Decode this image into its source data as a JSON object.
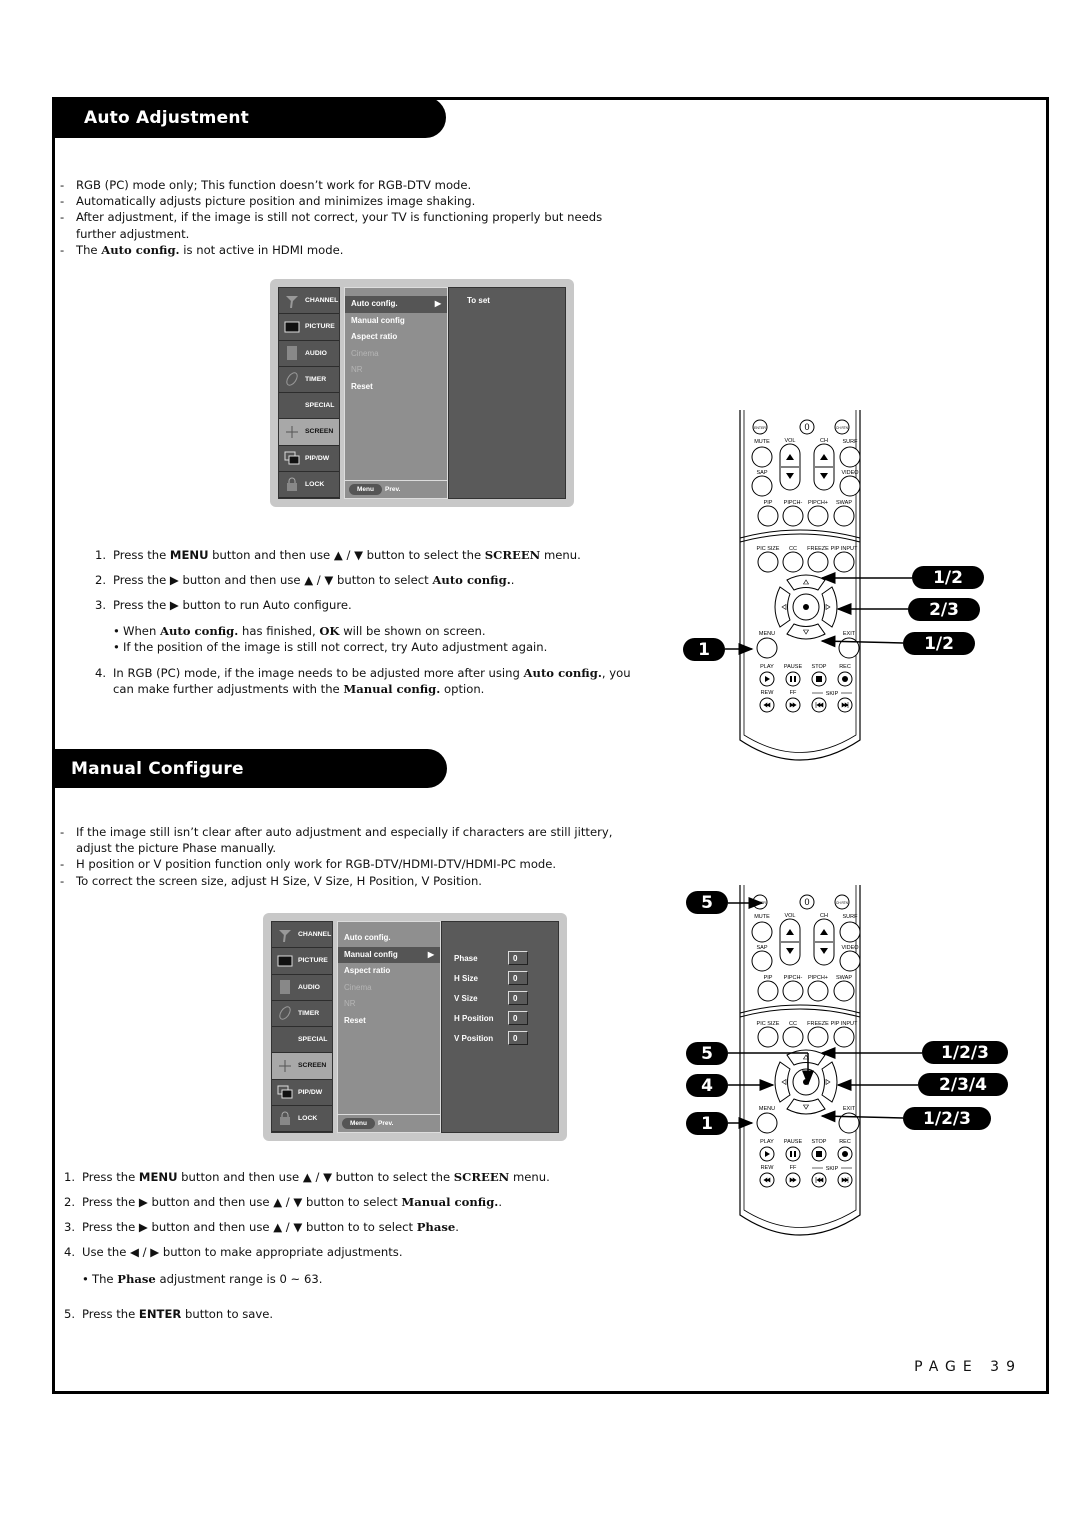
{
  "section1": {
    "title": "Auto Adjustment",
    "notes": [
      "RGB (PC) mode only; This function doesn’t work for RGB-DTV mode.",
      "Automatically adjusts picture position and minimizes image shaking.",
      "After adjustment, if the image is still not correct, your TV is functioning properly but needs further adjustment."
    ],
    "note4": {
      "pre": "The ",
      "bold": "Auto config.",
      "post": " is not active in HDMI mode."
    },
    "menu": {
      "sidebar": [
        "CHANNEL",
        "PICTURE",
        "AUDIO",
        "TIMER",
        "SPECIAL",
        "SCREEN",
        "PIP/DW",
        "LOCK"
      ],
      "selected_sidebar": "SCREEN",
      "items": [
        {
          "label": "Auto config.",
          "state": "highlighted",
          "arrow": "▶"
        },
        {
          "label": "Manual config",
          "state": "normal"
        },
        {
          "label": "Aspect ratio",
          "state": "normal"
        },
        {
          "label": "Cinema",
          "state": "disabled"
        },
        {
          "label": "NR",
          "state": "disabled"
        },
        {
          "label": "Reset",
          "state": "normal"
        }
      ],
      "right_text": "To set",
      "footer_button": "Menu",
      "footer_text": "Prev."
    },
    "steps": {
      "s1": {
        "num": "1.",
        "a": "Press the ",
        "b1": "MENU",
        "c": " button and then use ▲ / ▼  button to select the ",
        "b2": "SCREEN",
        "d": " menu."
      },
      "s2": {
        "num": "2.",
        "a": "Press the ▶ button and then use ▲ / ▼  button to select ",
        "b1": "Auto config.",
        "c": "."
      },
      "s3": {
        "num": "3.",
        "a": "Press the ▶ button to run Auto configure."
      },
      "bullet1": {
        "a": "When ",
        "b1": "Auto config.",
        "c": " has finished, ",
        "b2": "OK",
        "d": " will be shown on screen."
      },
      "bullet2": {
        "a": "If the position of the image is still not correct, try Auto adjustment again."
      },
      "s4": {
        "num": "4.",
        "a": "In RGB (PC) mode, if the image needs to be adjusted more after using ",
        "b1": "Auto config.",
        "c": ", you can make further adjustments with the ",
        "b2": "Manual config.",
        "d": " option."
      }
    },
    "badges": {
      "up": "1/2",
      "right": "2/3",
      "down": "1/2",
      "menu": "1"
    }
  },
  "section2": {
    "title": "Manual Configure",
    "notes": [
      "If the image still isn’t clear after auto adjustment and especially if characters are still jittery, adjust the picture Phase manually.",
      "H position or V position function only work for RGB-DTV/HDMI-DTV/HDMI-PC mode.",
      "To correct the screen size, adjust H Size, V Size, H Position, V Position."
    ],
    "menu": {
      "sidebar": [
        "CHANNEL",
        "PICTURE",
        "AUDIO",
        "TIMER",
        "SPECIAL",
        "SCREEN",
        "PIP/DW",
        "LOCK"
      ],
      "selected_sidebar": "SCREEN",
      "items": [
        {
          "label": "Auto config.",
          "state": "normal"
        },
        {
          "label": "Manual config",
          "state": "highlighted",
          "arrow": "▶"
        },
        {
          "label": "Aspect ratio",
          "state": "normal"
        },
        {
          "label": "Cinema",
          "state": "disabled"
        },
        {
          "label": "NR",
          "state": "disabled"
        },
        {
          "label": "Reset",
          "state": "normal"
        }
      ],
      "values": [
        {
          "label": "Phase",
          "value": "0"
        },
        {
          "label": "H Size",
          "value": "0"
        },
        {
          "label": "V Size",
          "value": "0"
        },
        {
          "label": "H Position",
          "value": "0"
        },
        {
          "label": "V Position",
          "value": "0"
        }
      ],
      "footer_button": "Menu",
      "footer_text": "Prev."
    },
    "steps": {
      "s1": {
        "num": "1.",
        "a": "Press the ",
        "b1": "MENU",
        "c": " button and then use ▲ / ▼  button to select the ",
        "b2": "SCREEN",
        "d": " menu."
      },
      "s2": {
        "num": "2.",
        "a": "Press the ▶ button and then use ▲ / ▼  button to select ",
        "b1": "Manual config.",
        "c": "."
      },
      "s3": {
        "num": "3.",
        "a": "Press the ▶ button and then use ▲ / ▼ button to to select ",
        "b1": "Phase",
        "c": "."
      },
      "s4": {
        "num": "4.",
        "a": "Use the ◀ / ▶ button to make appropriate adjustments."
      },
      "bullet1": {
        "a": "The ",
        "b1": "Phase",
        "c": "  adjustment range is 0 ~ 63."
      },
      "s5": {
        "num": "5.",
        "a": "Press the ",
        "b1": "ENTER",
        "c": " button to save."
      }
    },
    "badges": {
      "enter": "5",
      "ok": "5",
      "left": "4",
      "menu": "1",
      "up": "1/2/3",
      "right": "2/3/4",
      "down": "1/2/3"
    }
  },
  "remote": {
    "top_buttons": [
      "ENTER",
      "0",
      "CH RTN"
    ],
    "labels_row1": [
      "MUTE",
      "VOL",
      "CH",
      "SURF"
    ],
    "labels_row2": [
      "SAP",
      "VIDEO"
    ],
    "labels_row3": [
      "PIP",
      "PIPCH-",
      "PIPCH+",
      "SWAP"
    ],
    "labels_row4": [
      "PIC SIZE",
      "CC",
      "FREEZE",
      "PIP INPUT"
    ],
    "labels_row5": [
      "MENU",
      "EXIT"
    ],
    "labels_row6": [
      "PLAY",
      "PAUSE",
      "STOP",
      "REC"
    ],
    "labels_row7": [
      "REW",
      "FF",
      "SKIP"
    ]
  },
  "footer": {
    "page": "PAGE 39"
  }
}
